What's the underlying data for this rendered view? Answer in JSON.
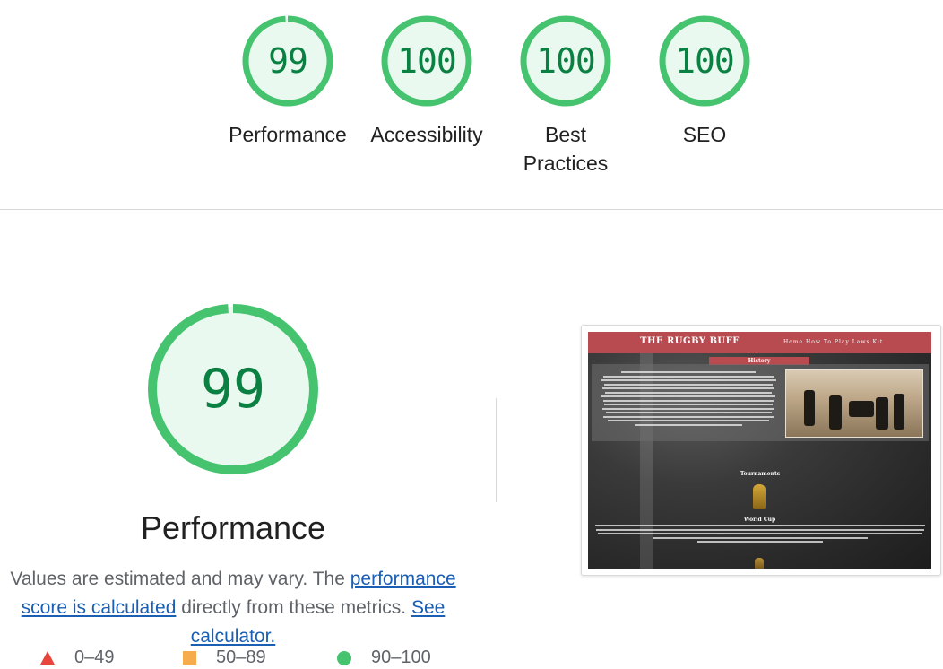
{
  "summary": {
    "gauges": [
      {
        "score": "99",
        "label": "Performance",
        "color": "#0cce6b"
      },
      {
        "score": "100",
        "label": "Accessibility",
        "color": "#0cce6b"
      },
      {
        "score": "100",
        "label": "Best Practices",
        "color": "#0cce6b"
      },
      {
        "score": "100",
        "label": "SEO",
        "color": "#0cce6b"
      }
    ]
  },
  "performance": {
    "score": "99",
    "title": "Performance",
    "desc_prefix": "Values are estimated and may vary. The ",
    "desc_link": "performance score is calculated",
    "desc_middle": " directly from these metrics. ",
    "desc_link2": "See calculator.",
    "legend": [
      {
        "range": "0–49",
        "icon": "triangle-fail-icon",
        "color": "#ff4e42"
      },
      {
        "range": "50–89",
        "icon": "square-average-icon",
        "color": "#ffa400"
      },
      {
        "range": "90–100",
        "icon": "circle-pass-icon",
        "color": "#0cce6b"
      }
    ]
  },
  "screenshot": {
    "site_title": "THE RUGBY BUFF",
    "nav_links": "Home  How To Play  Laws  Kit",
    "history_heading": "History",
    "tournaments_heading": "Tournaments",
    "world_cup_heading": "World Cup"
  },
  "colors": {
    "pass_green": "#0cce6b",
    "pass_text": "#008800",
    "pass_fill": "#e6f9ee",
    "link": "#1a73e8"
  }
}
